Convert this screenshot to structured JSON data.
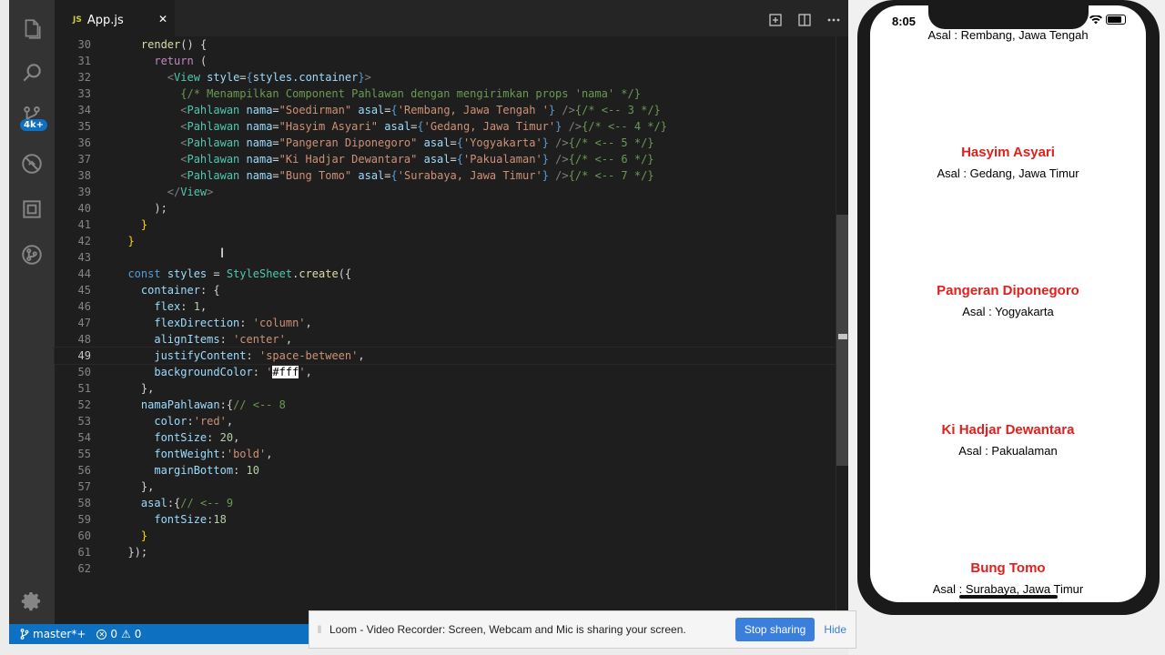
{
  "editor": {
    "tab_label": "App.js",
    "tab_icon": "JS",
    "lines": [
      {
        "n": "30",
        "tokens": [
          [
            "    ",
            ""
          ],
          [
            "render",
            "t-fn"
          ],
          [
            "() {",
            ""
          ]
        ]
      },
      {
        "n": "31",
        "tokens": [
          [
            "      ",
            ""
          ],
          [
            "return",
            "t-kw"
          ],
          [
            " (",
            ""
          ]
        ]
      },
      {
        "n": "32",
        "tokens": [
          [
            "        ",
            ""
          ],
          [
            "<",
            "t-tag"
          ],
          [
            "View",
            "t-cls"
          ],
          [
            " ",
            ""
          ],
          [
            "style",
            "t-var"
          ],
          [
            "=",
            ""
          ],
          [
            "{",
            "t-kw2"
          ],
          [
            "styles.container",
            "t-var"
          ],
          [
            "}",
            "t-kw2"
          ],
          [
            ">",
            "t-tag"
          ]
        ]
      },
      {
        "n": "33",
        "tokens": [
          [
            "          ",
            ""
          ],
          [
            "{/* Menampilkan Component Pahlawan dengan mengirimkan props 'nama' */}",
            "t-com"
          ]
        ]
      },
      {
        "n": "34",
        "tokens": [
          [
            "          ",
            ""
          ],
          [
            "<",
            "t-tag"
          ],
          [
            "Pahlawan",
            "t-cls"
          ],
          [
            " ",
            ""
          ],
          [
            "nama",
            "t-var"
          ],
          [
            "=",
            ""
          ],
          [
            "\"Soedirman\"",
            "t-str"
          ],
          [
            " ",
            ""
          ],
          [
            "asal",
            "t-var"
          ],
          [
            "=",
            ""
          ],
          [
            "{",
            "t-kw2"
          ],
          [
            "'Rembang, Jawa Tengah '",
            "t-str"
          ],
          [
            "}",
            "t-kw2"
          ],
          [
            " />",
            "t-tag"
          ],
          [
            "{/* <-- 3 */}",
            "t-com"
          ]
        ]
      },
      {
        "n": "35",
        "tokens": [
          [
            "          ",
            ""
          ],
          [
            "<",
            "t-tag"
          ],
          [
            "Pahlawan",
            "t-cls"
          ],
          [
            " ",
            ""
          ],
          [
            "nama",
            "t-var"
          ],
          [
            "=",
            ""
          ],
          [
            "\"Hasyim Asyari\"",
            "t-str"
          ],
          [
            " ",
            ""
          ],
          [
            "asal",
            "t-var"
          ],
          [
            "=",
            ""
          ],
          [
            "{",
            "t-kw2"
          ],
          [
            "'Gedang, Jawa Timur'",
            "t-str"
          ],
          [
            "}",
            "t-kw2"
          ],
          [
            " />",
            "t-tag"
          ],
          [
            "{/* <-- 4 */}",
            "t-com"
          ]
        ]
      },
      {
        "n": "36",
        "tokens": [
          [
            "          ",
            ""
          ],
          [
            "<",
            "t-tag"
          ],
          [
            "Pahlawan",
            "t-cls"
          ],
          [
            " ",
            ""
          ],
          [
            "nama",
            "t-var"
          ],
          [
            "=",
            ""
          ],
          [
            "\"Pangeran Diponegoro\"",
            "t-str"
          ],
          [
            " ",
            ""
          ],
          [
            "asal",
            "t-var"
          ],
          [
            "=",
            ""
          ],
          [
            "{",
            "t-kw2"
          ],
          [
            "'Yogyakarta'",
            "t-str"
          ],
          [
            "}",
            "t-kw2"
          ],
          [
            " />",
            "t-tag"
          ],
          [
            "{/* <-- 5 */}",
            "t-com"
          ]
        ]
      },
      {
        "n": "37",
        "tokens": [
          [
            "          ",
            ""
          ],
          [
            "<",
            "t-tag"
          ],
          [
            "Pahlawan",
            "t-cls"
          ],
          [
            " ",
            ""
          ],
          [
            "nama",
            "t-var"
          ],
          [
            "=",
            ""
          ],
          [
            "\"Ki Hadjar Dewantara\"",
            "t-str"
          ],
          [
            " ",
            ""
          ],
          [
            "asal",
            "t-var"
          ],
          [
            "=",
            ""
          ],
          [
            "{",
            "t-kw2"
          ],
          [
            "'Pakualaman'",
            "t-str"
          ],
          [
            "}",
            "t-kw2"
          ],
          [
            " />",
            "t-tag"
          ],
          [
            "{/* <-- 6 */}",
            "t-com"
          ]
        ]
      },
      {
        "n": "38",
        "tokens": [
          [
            "          ",
            ""
          ],
          [
            "<",
            "t-tag"
          ],
          [
            "Pahlawan",
            "t-cls"
          ],
          [
            " ",
            ""
          ],
          [
            "nama",
            "t-var"
          ],
          [
            "=",
            ""
          ],
          [
            "\"Bung Tomo\"",
            "t-str"
          ],
          [
            " ",
            ""
          ],
          [
            "asal",
            "t-var"
          ],
          [
            "=",
            ""
          ],
          [
            "{",
            "t-kw2"
          ],
          [
            "'Surabaya, Jawa Timur'",
            "t-str"
          ],
          [
            "}",
            "t-kw2"
          ],
          [
            " />",
            "t-tag"
          ],
          [
            "{/* <-- 7 */}",
            "t-com"
          ]
        ]
      },
      {
        "n": "39",
        "tokens": [
          [
            "        ",
            ""
          ],
          [
            "</",
            "t-tag"
          ],
          [
            "View",
            "t-cls"
          ],
          [
            ">",
            "t-tag"
          ]
        ]
      },
      {
        "n": "40",
        "tokens": [
          [
            "      ",
            ""
          ],
          [
            ");",
            ""
          ]
        ]
      },
      {
        "n": "41",
        "tokens": [
          [
            "    ",
            ""
          ],
          [
            "}",
            "t-br"
          ]
        ]
      },
      {
        "n": "42",
        "tokens": [
          [
            "  ",
            ""
          ],
          [
            "}",
            "t-br"
          ]
        ]
      },
      {
        "n": "43",
        "tokens": []
      },
      {
        "n": "44",
        "tokens": [
          [
            "  ",
            ""
          ],
          [
            "const",
            "t-kw2"
          ],
          [
            " ",
            ""
          ],
          [
            "styles",
            "t-var"
          ],
          [
            " = ",
            ""
          ],
          [
            "StyleSheet",
            "t-cls"
          ],
          [
            ".",
            ""
          ],
          [
            "create",
            "t-fn"
          ],
          [
            "({",
            ""
          ]
        ]
      },
      {
        "n": "45",
        "tokens": [
          [
            "    ",
            ""
          ],
          [
            "container",
            "t-var"
          ],
          [
            ": {",
            ""
          ]
        ]
      },
      {
        "n": "46",
        "tokens": [
          [
            "      ",
            ""
          ],
          [
            "flex",
            "t-var"
          ],
          [
            ": ",
            ""
          ],
          [
            "1",
            "t-num"
          ],
          [
            ",",
            ""
          ]
        ]
      },
      {
        "n": "47",
        "tokens": [
          [
            "      ",
            ""
          ],
          [
            "flexDirection",
            "t-var"
          ],
          [
            ": ",
            ""
          ],
          [
            "'column'",
            "t-str"
          ],
          [
            ",",
            ""
          ]
        ]
      },
      {
        "n": "48",
        "tokens": [
          [
            "      ",
            ""
          ],
          [
            "alignItems",
            "t-var"
          ],
          [
            ": ",
            ""
          ],
          [
            "'center'",
            "t-str"
          ],
          [
            ",",
            ""
          ]
        ]
      },
      {
        "n": "49",
        "tokens": [
          [
            "      ",
            ""
          ],
          [
            "justifyContent",
            "t-var"
          ],
          [
            ": ",
            ""
          ],
          [
            "'space-between'",
            "t-str"
          ],
          [
            ",",
            ""
          ]
        ],
        "current": true
      },
      {
        "n": "50",
        "tokens": [
          [
            "      ",
            ""
          ],
          [
            "backgroundColor",
            "t-var"
          ],
          [
            ": ",
            ""
          ],
          [
            "'",
            "t-str"
          ],
          [
            "#fff",
            "sel-hl"
          ],
          [
            "'",
            "t-str"
          ],
          [
            ",",
            ""
          ]
        ]
      },
      {
        "n": "51",
        "tokens": [
          [
            "    ",
            ""
          ],
          [
            "},",
            ""
          ]
        ]
      },
      {
        "n": "52",
        "tokens": [
          [
            "    ",
            ""
          ],
          [
            "namaPahlawan",
            "t-var"
          ],
          [
            ":{",
            ""
          ],
          [
            "// <-- 8",
            "t-com"
          ]
        ]
      },
      {
        "n": "53",
        "tokens": [
          [
            "      ",
            ""
          ],
          [
            "color",
            "t-var"
          ],
          [
            ":",
            ""
          ],
          [
            "'red'",
            "t-str"
          ],
          [
            ",",
            ""
          ]
        ]
      },
      {
        "n": "54",
        "tokens": [
          [
            "      ",
            ""
          ],
          [
            "fontSize",
            "t-var"
          ],
          [
            ": ",
            ""
          ],
          [
            "20",
            "t-num"
          ],
          [
            ",",
            ""
          ]
        ]
      },
      {
        "n": "55",
        "tokens": [
          [
            "      ",
            ""
          ],
          [
            "fontWeight",
            "t-var"
          ],
          [
            ":",
            ""
          ],
          [
            "'bold'",
            "t-str"
          ],
          [
            ",",
            ""
          ]
        ]
      },
      {
        "n": "56",
        "tokens": [
          [
            "      ",
            ""
          ],
          [
            "marginBottom",
            "t-var"
          ],
          [
            ": ",
            ""
          ],
          [
            "10",
            "t-num"
          ]
        ]
      },
      {
        "n": "57",
        "tokens": [
          [
            "    ",
            ""
          ],
          [
            "},",
            ""
          ]
        ]
      },
      {
        "n": "58",
        "tokens": [
          [
            "    ",
            ""
          ],
          [
            "asal",
            "t-var"
          ],
          [
            ":{",
            ""
          ],
          [
            "// <-- 9",
            "t-com"
          ]
        ]
      },
      {
        "n": "59",
        "tokens": [
          [
            "      ",
            ""
          ],
          [
            "fontSize",
            "t-var"
          ],
          [
            ":",
            ""
          ],
          [
            "18",
            "t-num"
          ]
        ]
      },
      {
        "n": "60",
        "tokens": [
          [
            "    ",
            ""
          ],
          [
            "}",
            "t-br"
          ]
        ]
      },
      {
        "n": "61",
        "tokens": [
          [
            "  ",
            ""
          ],
          [
            "});",
            ""
          ]
        ]
      },
      {
        "n": "62",
        "tokens": []
      }
    ]
  },
  "statusbar": {
    "branch": "master*+",
    "errors": "0",
    "warnings": "0"
  },
  "phone": {
    "time": "8:05",
    "top_asal": "Asal : Rembang, Jawa Tengah",
    "heroes": [
      {
        "name": "Hasyim Asyari",
        "asal": "Asal : Gedang, Jawa Timur"
      },
      {
        "name": "Pangeran Diponegoro",
        "asal": "Asal : Yogyakarta"
      },
      {
        "name": "Ki Hadjar Dewantara",
        "asal": "Asal : Pakualaman"
      },
      {
        "name": "Bung Tomo",
        "asal": "Asal : Surabaya, Jawa Timur"
      }
    ]
  },
  "loom": {
    "message": "Loom - Video Recorder: Screen, Webcam and Mic is sharing your screen.",
    "stop_label": "Stop sharing",
    "hide_label": "Hide"
  },
  "icons": {
    "explorer": "files-icon",
    "search": "search-icon",
    "scm": "source-control-icon",
    "scm_badge": "4k+",
    "debug": "debug-icon",
    "extensions": "extensions-icon",
    "gitlens": "git-graph-icon",
    "settings": "gear-icon"
  }
}
